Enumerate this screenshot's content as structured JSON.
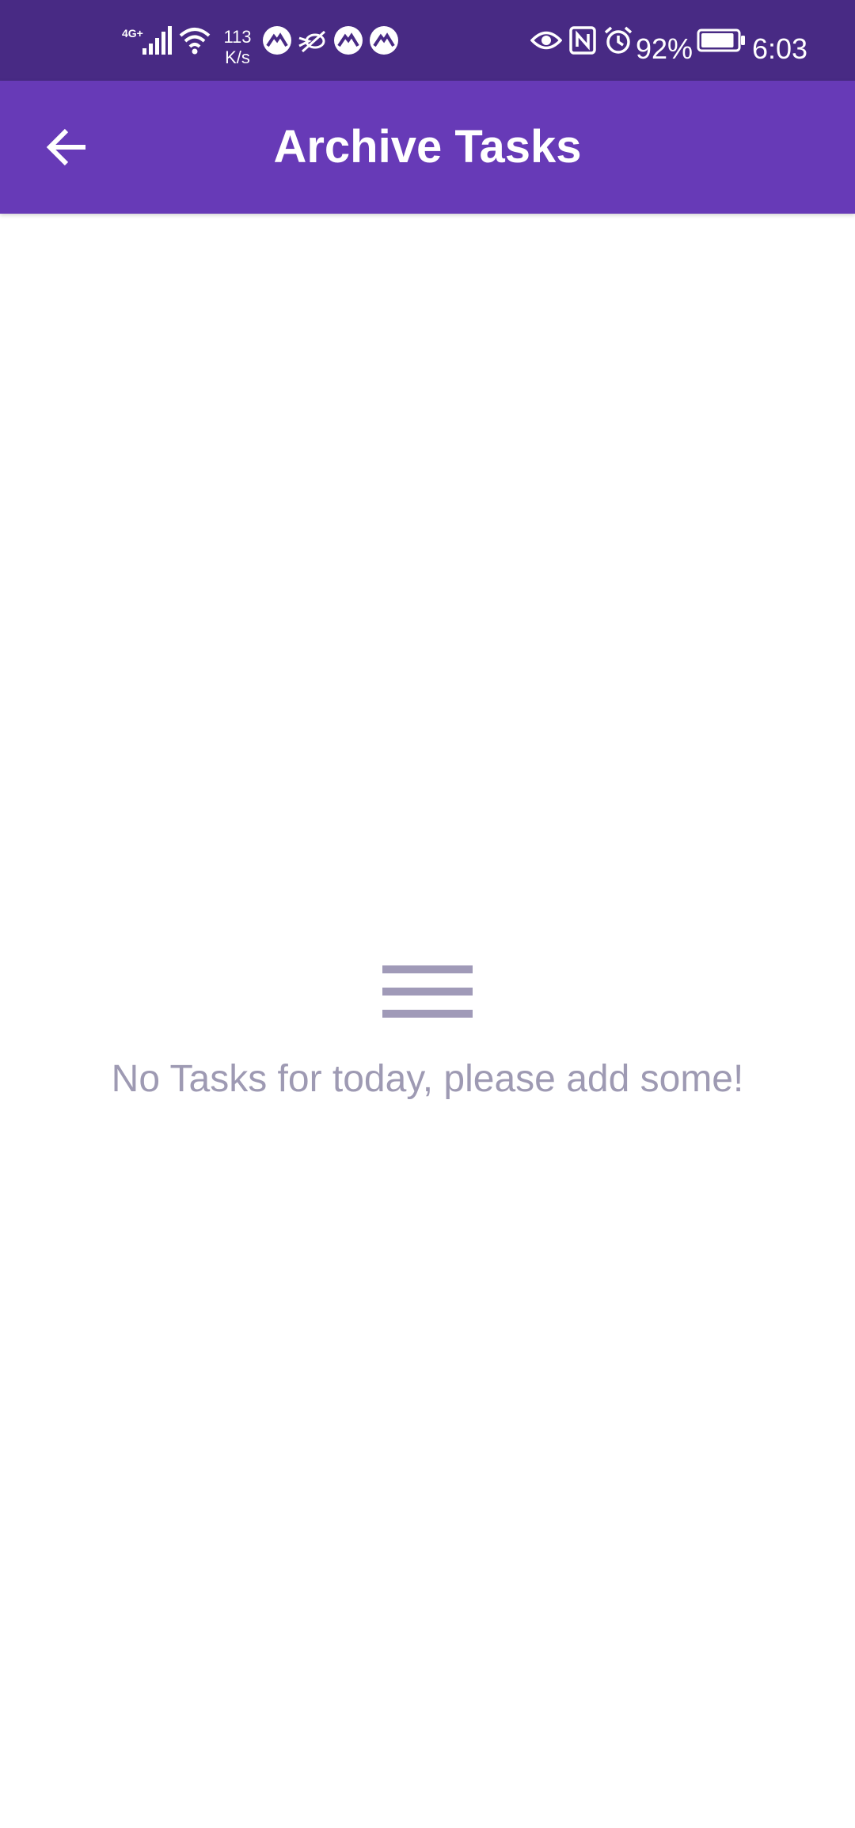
{
  "status_bar": {
    "network_type": "4G+",
    "net_speed_value": "113",
    "net_speed_unit": "K/s",
    "battery_percent": "92%",
    "battery_level": 0.92,
    "time": "6:03",
    "icons": [
      "signal-icon",
      "wifi-icon",
      "app-notification-icon",
      "bird-icon",
      "app-notification-icon",
      "app-notification-icon",
      "eye-icon",
      "nfc-icon",
      "alarm-icon",
      "battery-icon"
    ]
  },
  "app_bar": {
    "title": "Archive Tasks",
    "back_icon": "arrow-left-icon",
    "background_color": "#673ab7"
  },
  "empty_state": {
    "icon": "menu-lines-icon",
    "message": "No Tasks for today, please add some!",
    "text_color": "#9e9ab3"
  }
}
